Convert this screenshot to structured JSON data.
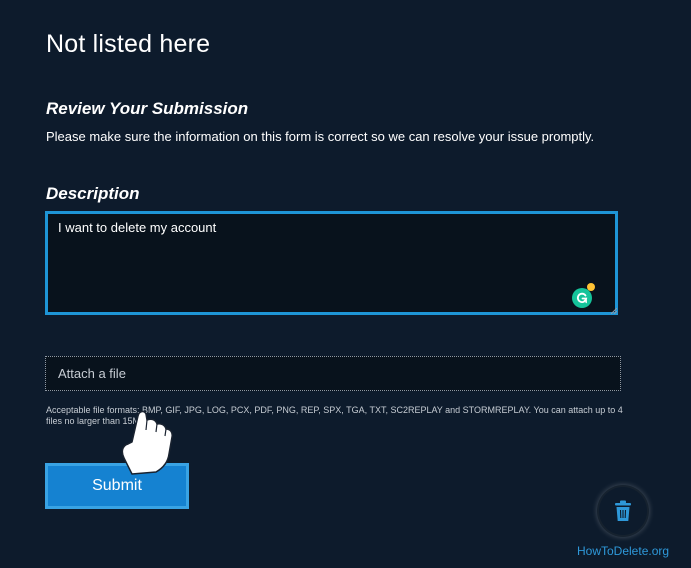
{
  "page": {
    "title": "Not listed here"
  },
  "review": {
    "heading": "Review Your Submission",
    "text": "Please make sure the information on this form is correct so we can resolve your issue promptly."
  },
  "description": {
    "heading": "Description",
    "value": "I want to delete my account"
  },
  "attach": {
    "label": "Attach a file",
    "info": "Acceptable file formats: BMP, GIF, JPG, LOG, PCX, PDF, PNG, REP, SPX, TGA, TXT, SC2REPLAY and STORMREPLAY. You can attach up to 4 files no larger than 15MB."
  },
  "actions": {
    "submit_label": "Submit"
  },
  "watermark": {
    "text": "HowToDelete.org"
  },
  "icons": {
    "grammarly": "grammarly-icon",
    "pointer": "hand-pointer-icon",
    "trash": "trash-icon"
  },
  "colors": {
    "background": "#0d1b2c",
    "accent": "#1e95d6",
    "button": "#1582d1",
    "grammarly": "#15c39a",
    "watermark": "#2e98d9"
  }
}
